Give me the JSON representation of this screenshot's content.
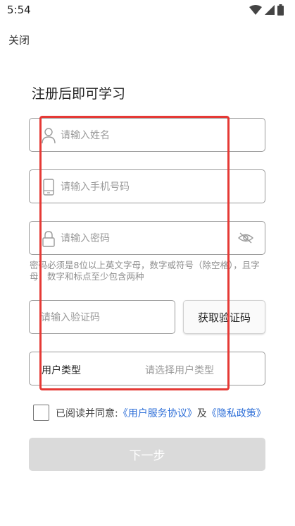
{
  "status_bar": {
    "time": "5:54"
  },
  "header": {
    "close_label": "关闭"
  },
  "title": "注册后即可学习",
  "fields": {
    "name_placeholder": "请输入姓名",
    "phone_placeholder": "请输入手机号码",
    "password_placeholder": "请输入密码"
  },
  "password_hint": "密码必须是8位以上英文字母，数字或符号（除空格），且字母，数字和标点至少包含两种",
  "verify": {
    "code_placeholder": "请输入验证码",
    "get_code_label": "获取验证码"
  },
  "user_type": {
    "label": "用户类型",
    "placeholder": "请选择用户类型"
  },
  "agreement": {
    "prefix": "已阅读并同意:",
    "service_link": "《用户服务协议》",
    "conjunction": "及",
    "privacy_link": "《隐私政策》",
    "checked": false
  },
  "next_label": "下一步",
  "colors": {
    "link": "#2e6fd8",
    "highlight": "#e53935",
    "disabled_button": "#dadada"
  }
}
